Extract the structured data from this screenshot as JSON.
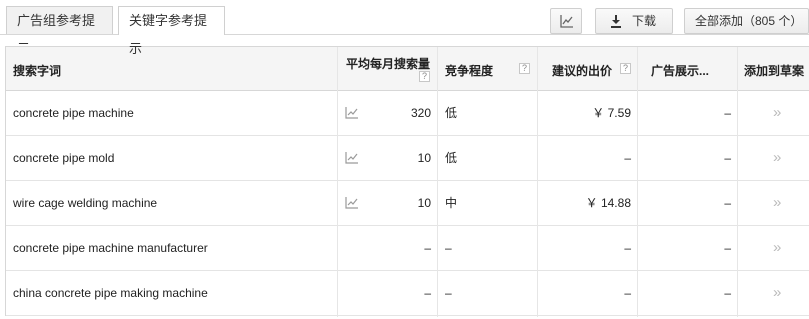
{
  "tabs": [
    {
      "label": "广告组参考提示",
      "active": false
    },
    {
      "label": "关键字参考提示",
      "active": true
    }
  ],
  "toolbar": {
    "chart_icon": "line-chart-icon",
    "download_icon": "download-icon",
    "download_label": "下载",
    "add_all_label": "全部添加（805 个）"
  },
  "table": {
    "columns": {
      "keyword": "搜索字词",
      "searches": "平均每月搜索量",
      "competition": "竞争程度",
      "bid": "建议的出价",
      "share": "广告展示...",
      "add": "添加到草案"
    },
    "help_glyph": "?",
    "rows": [
      {
        "keyword": "concrete pipe machine",
        "has_trend": true,
        "searches": "320",
        "competition": "低",
        "bid": "￥ 7.59",
        "share": "–",
        "add": "»"
      },
      {
        "keyword": "concrete pipe mold",
        "has_trend": true,
        "searches": "10",
        "competition": "低",
        "bid": "–",
        "share": "–",
        "add": "»"
      },
      {
        "keyword": "wire cage welding machine",
        "has_trend": true,
        "searches": "10",
        "competition": "中",
        "bid": "￥ 14.88",
        "share": "–",
        "add": "»"
      },
      {
        "keyword": "concrete pipe machine manufacturer",
        "has_trend": false,
        "searches": "–",
        "competition": "–",
        "bid": "–",
        "share": "–",
        "add": "»"
      },
      {
        "keyword": "china concrete pipe making machine",
        "has_trend": false,
        "searches": "–",
        "competition": "–",
        "bid": "–",
        "share": "–",
        "add": "»"
      }
    ]
  },
  "colors": {
    "border": "#d7d7d7",
    "header_bg": "#f5f5f5",
    "arrow": "#bbbbbb",
    "icon": "#9a9a9a"
  }
}
